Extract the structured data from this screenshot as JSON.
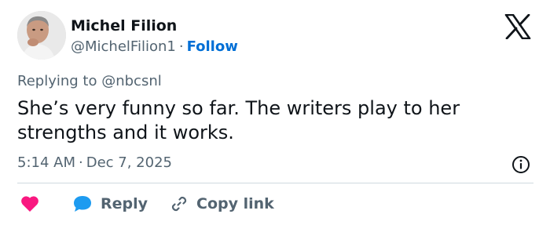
{
  "author": {
    "name": "Michel Filion",
    "handle": "@MichelFilion1",
    "separator": "·",
    "follow_label": "Follow"
  },
  "reply_context": {
    "prefix": "Replying to",
    "mention": "@nbcsnl"
  },
  "tweet": {
    "text": "She’s very funny so far. The writers play to her strengths and it works."
  },
  "meta": {
    "time": "5:14 AM",
    "separator": "·",
    "date": "Dec 7, 2025"
  },
  "actions": {
    "reply_label": "Reply",
    "copy_link_label": "Copy link"
  },
  "icons": {
    "brand": "x-logo-icon",
    "info": "info-icon",
    "like": "heart-icon",
    "reply": "speech-bubble-icon",
    "copy": "link-icon"
  },
  "colors": {
    "text": "#0f1419",
    "secondary": "#536471",
    "follow": "#006fd6",
    "heart": "#f91880",
    "reply_bubble": "#1d9bf0",
    "divider": "#cfd9de"
  }
}
